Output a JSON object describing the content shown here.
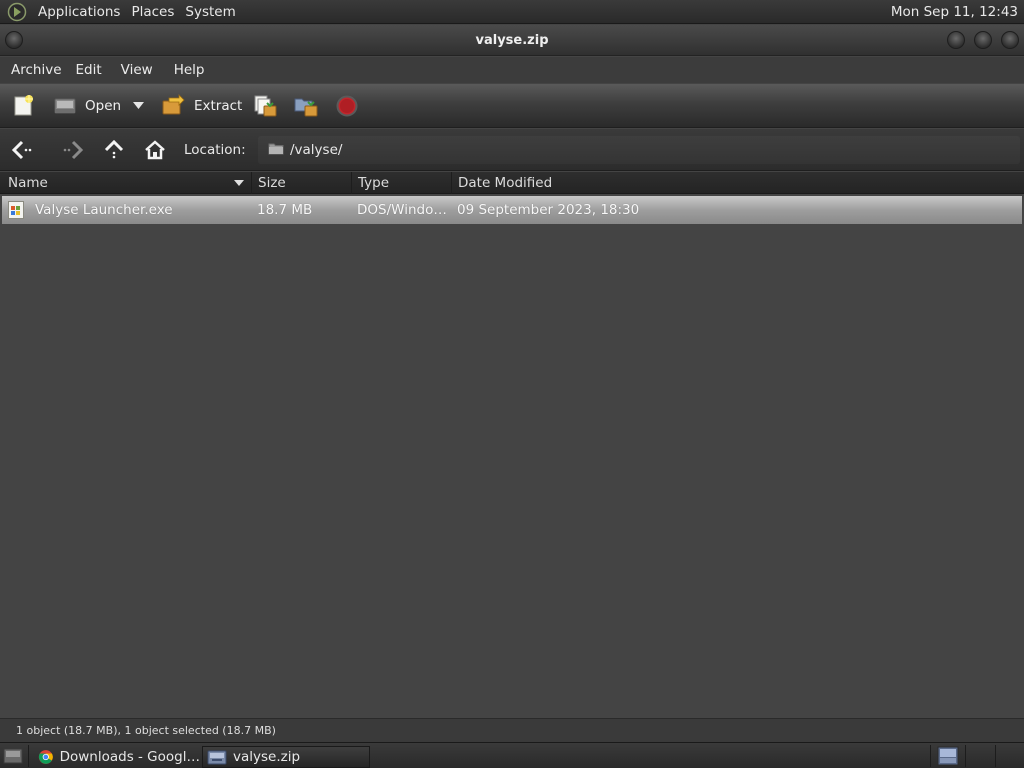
{
  "top_panel": {
    "menus": [
      "Applications",
      "Places",
      "System"
    ],
    "clock": "Mon Sep 11, 12:43"
  },
  "window": {
    "title": "valyse.zip"
  },
  "menubar": {
    "items": [
      "Archive",
      "Edit",
      "View",
      "Help"
    ]
  },
  "toolbar": {
    "open_label": "Open",
    "extract_label": "Extract"
  },
  "location": {
    "label": "Location:",
    "path": "/valyse/"
  },
  "columns": [
    "Name",
    "Size",
    "Type",
    "Date Modified"
  ],
  "files": [
    {
      "name": "Valyse Launcher.exe",
      "size": "18.7 MB",
      "type": "DOS/Windo…",
      "modified": "09 September 2023, 18:30",
      "selected": true
    }
  ],
  "status": "1 object (18.7 MB), 1 object selected (18.7 MB)",
  "taskbar": {
    "tasks": [
      {
        "label": "Downloads - Googl…",
        "icon": "chrome-icon",
        "active": false
      },
      {
        "label": "valyse.zip",
        "icon": "archive-icon",
        "active": true
      }
    ]
  },
  "colors": {
    "background": "#444444",
    "selection": "#a8a8a8",
    "stop": "#c0262c"
  }
}
